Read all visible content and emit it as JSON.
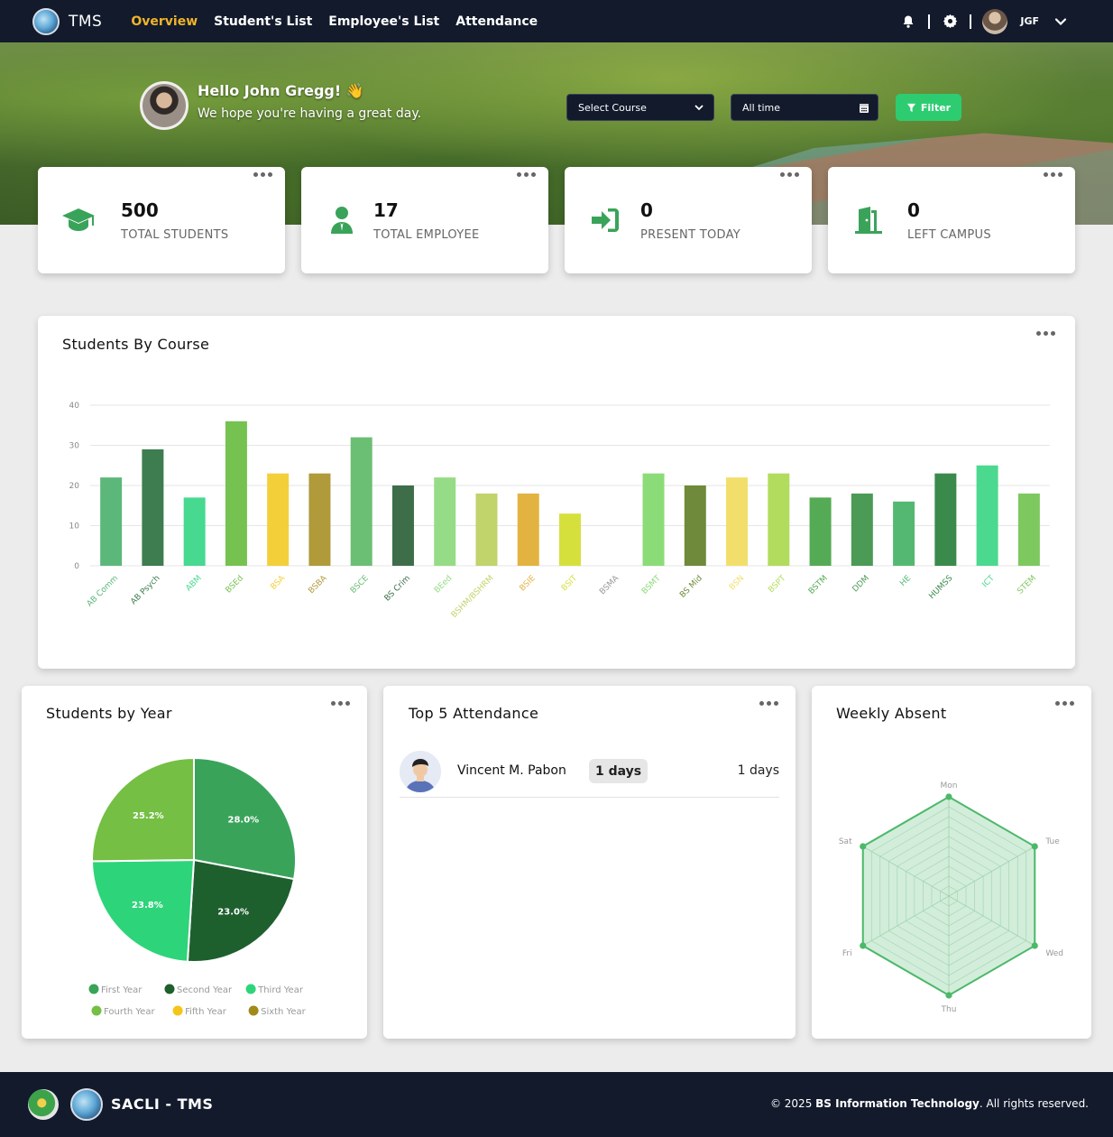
{
  "navbar": {
    "brand": "TMS",
    "links": [
      "Overview",
      "Student's List",
      "Employee's List",
      "Attendance"
    ],
    "active_link": "Overview",
    "user_initials": "JGF"
  },
  "hero": {
    "greeting": "Hello John Gregg!",
    "wave_emoji": "👋",
    "subtitle": "We hope you're having a great day.",
    "course_select": "Select Course",
    "date_range": "All time",
    "filter_label": "Filter"
  },
  "stats": [
    {
      "value": "500",
      "label": "TOTAL STUDENTS",
      "icon": "graduation-cap-icon"
    },
    {
      "value": "17",
      "label": "TOTAL EMPLOYEE",
      "icon": "user-tie-icon"
    },
    {
      "value": "0",
      "label": "PRESENT TODAY",
      "icon": "sign-in-icon"
    },
    {
      "value": "0",
      "label": "LEFT CAMPUS",
      "icon": "door-open-icon"
    }
  ],
  "panels": {
    "course_title": "Students By Course",
    "year_title": "Students by Year",
    "attendance_title": "Top 5 Attendance",
    "absent_title": "Weekly Absent"
  },
  "attendance": [
    {
      "name": "Vincent M. Pabon",
      "badge": "1 days",
      "days": "1 days"
    }
  ],
  "colors": {
    "navbar": "#121a2c",
    "active_link": "#f0b429",
    "accent_green": "#2ecc71",
    "icon_green": "#3aa35a"
  },
  "chart_data": [
    {
      "type": "bar",
      "title": "Students By Course",
      "categories": [
        "AB Comm",
        "AB Psych",
        "ABM",
        "BSEd",
        "BSA",
        "BSBA",
        "BSCE",
        "BS Crim",
        "BEed",
        "BSHM/BSHRM",
        "BSIE",
        "BSIT",
        "BSMA",
        "BSMT",
        "BS Mid",
        "BSN",
        "BSPT",
        "BSTM",
        "DDM",
        "HE",
        "HUMSS",
        "ICT",
        "STEM"
      ],
      "values": [
        22,
        29,
        17,
        36,
        23,
        23,
        32,
        20,
        22,
        18,
        18,
        13,
        0,
        23,
        20,
        22,
        23,
        17,
        18,
        16,
        23,
        25,
        18
      ],
      "colors": [
        "#5cb87a",
        "#3d7d4f",
        "#47d98f",
        "#76c251",
        "#f3cf3a",
        "#b09a3a",
        "#6bbf74",
        "#3e6d4a",
        "#96dc86",
        "#c1d36b",
        "#e3b341",
        "#d6e03d",
        "#999999",
        "#8bdc78",
        "#6e8a3a",
        "#f2df6b",
        "#b2dc5e",
        "#55ab55",
        "#4b9a55",
        "#55b872",
        "#3a8a4b",
        "#4bd98f",
        "#7ec860"
      ],
      "ylim": [
        0,
        40
      ],
      "yticks": [
        0,
        10,
        20,
        30,
        40
      ],
      "grid": true
    },
    {
      "type": "pie",
      "title": "Students by Year",
      "labels": [
        "First Year",
        "Second Year",
        "Third Year",
        "Fourth Year",
        "Fifth Year",
        "Sixth Year"
      ],
      "values": [
        28.0,
        23.0,
        23.8,
        25.2,
        0,
        0
      ],
      "value_labels": [
        "28.0%",
        "23.0%",
        "23.8%",
        "25.2%",
        "",
        ""
      ],
      "colors": [
        "#3aa35a",
        "#1e5f2e",
        "#2ed47a",
        "#74bf44",
        "#f5c518",
        "#a08a1a"
      ],
      "legend": "bottom"
    },
    {
      "type": "radar",
      "title": "Weekly Absent",
      "categories": [
        "Mon",
        "Tue",
        "Wed",
        "Thu",
        "Fri",
        "Sat"
      ],
      "values": [
        0,
        0,
        0,
        0,
        0,
        0
      ],
      "color": "#4cb86a"
    }
  ],
  "footer": {
    "name": "SACLI - TMS",
    "copyright_prefix": "© 2025",
    "copyright_org": "BS Information Technology",
    "copyright_suffix": ". All rights reserved."
  }
}
